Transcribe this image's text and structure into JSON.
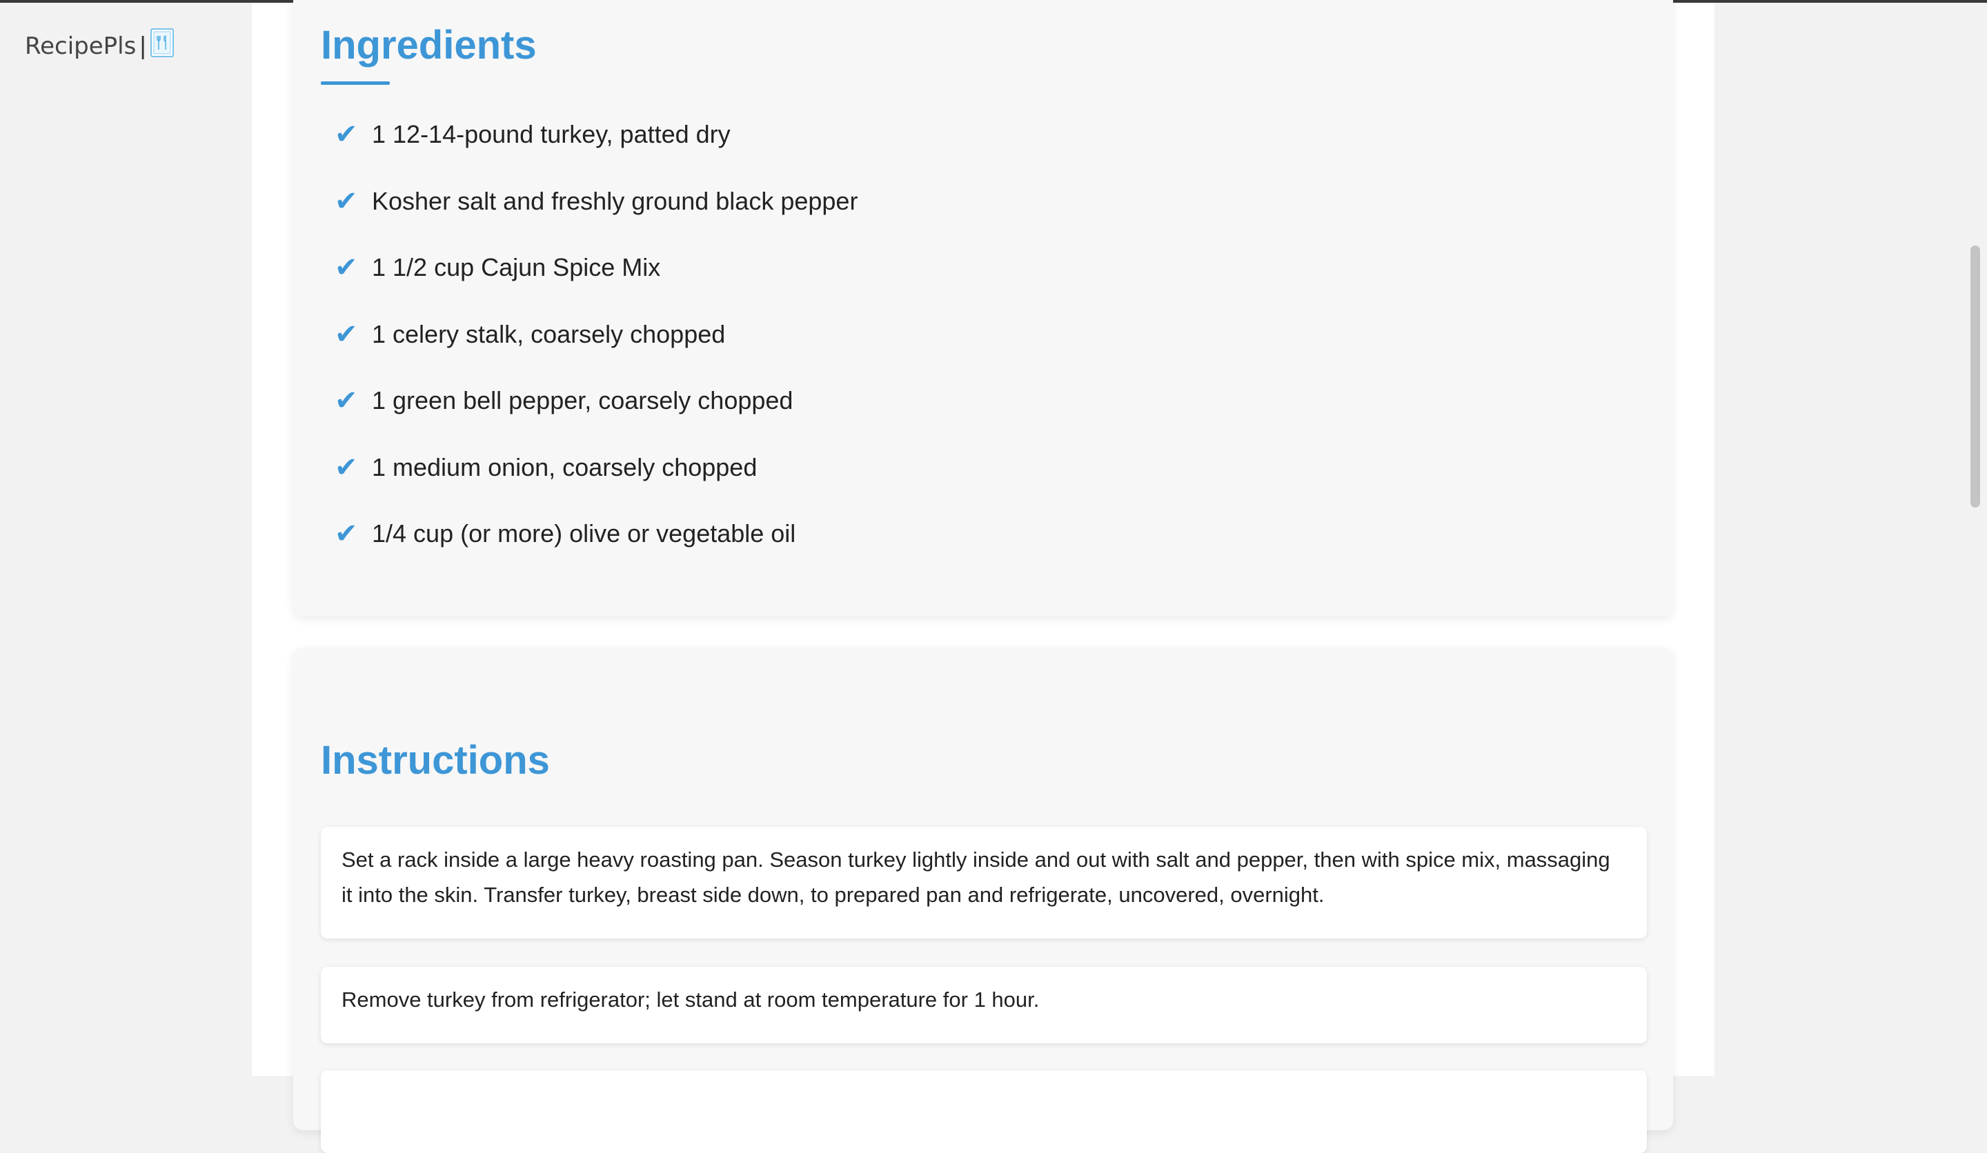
{
  "brand": {
    "name": "RecipePls",
    "separator": "|",
    "icon": "recipe-book-icon"
  },
  "colors": {
    "accent": "#3d96d6",
    "background": "#f2f2f2",
    "card": "#f7f7f7"
  },
  "ingredients": {
    "title": "Ingredients",
    "check_icon": "checkmark-icon",
    "items": [
      {
        "check": "✔",
        "text": "1 12-14-pound turkey, patted dry"
      },
      {
        "check": "✔",
        "text": "Kosher salt and freshly ground black pepper"
      },
      {
        "check": "✔",
        "text": "1 1/2 cup Cajun Spice Mix"
      },
      {
        "check": "✔",
        "text": "1 celery stalk, coarsely chopped"
      },
      {
        "check": "✔",
        "text": "1 green bell pepper, coarsely chopped"
      },
      {
        "check": "✔",
        "text": "1 medium onion, coarsely chopped"
      },
      {
        "check": "✔",
        "text": "1/4 cup (or more) olive or vegetable oil"
      }
    ]
  },
  "instructions": {
    "title": "Instructions",
    "steps": [
      {
        "text": "Set a rack inside a large heavy roasting pan. Season turkey lightly inside and out with salt and pepper, then with spice mix, massaging it into the skin. Transfer turkey, breast side down, to prepared pan and refrigerate, uncovered, overnight."
      },
      {
        "text": "Remove turkey from refrigerator; let stand at room temperature for 1 hour."
      },
      {
        "text": ""
      }
    ]
  }
}
